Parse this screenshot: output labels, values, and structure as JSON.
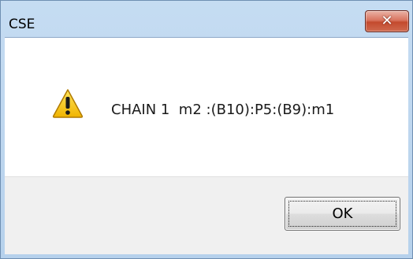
{
  "dialog": {
    "title": "CSE",
    "close_icon": "close-icon",
    "icon": "warning-icon",
    "message": "CHAIN 1  m2 :(B10):P5:(B9):m1",
    "ok_label": "OK"
  },
  "colors": {
    "frame": "#c5dcf2",
    "close_button": "#c44a2e",
    "warning_yellow": "#f5c800",
    "content_bg": "#ffffff",
    "footer_bg": "#f0f0f0"
  }
}
